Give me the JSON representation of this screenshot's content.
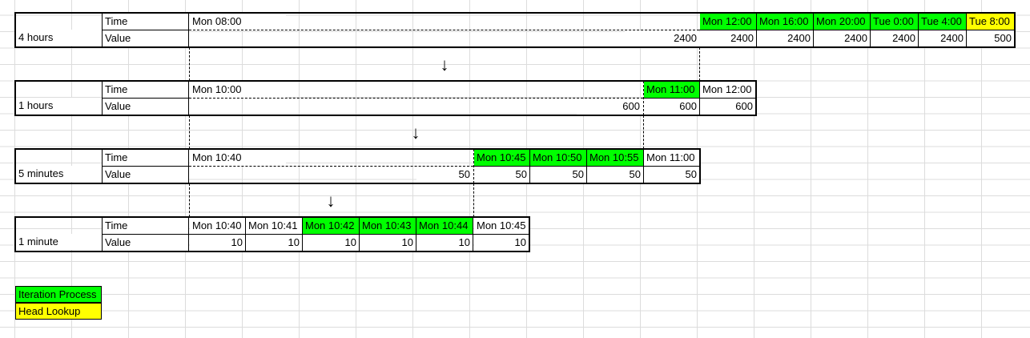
{
  "rows_label": {
    "time": "Time",
    "value": "Value"
  },
  "sections": [
    {
      "resolution": "4 hours",
      "time_cells": [
        "Mon 08:00",
        "Mon 12:00",
        "Mon 16:00",
        "Mon 20:00",
        "Tue 0:00",
        "Tue 4:00",
        "Tue 8:00"
      ],
      "value_cells": [
        "2400",
        "2400",
        "2400",
        "2400",
        "2400",
        "2400",
        "500"
      ],
      "highlight": [
        "none",
        "green",
        "green",
        "green",
        "green",
        "green",
        "yellow"
      ]
    },
    {
      "resolution": "1 hours",
      "time_cells": [
        "Mon 10:00",
        "Mon 11:00",
        "Mon 12:00"
      ],
      "value_cells": [
        "600",
        "600",
        "600"
      ],
      "highlight": [
        "none",
        "green",
        "none"
      ]
    },
    {
      "resolution": "5 minutes",
      "time_cells": [
        "Mon 10:40",
        "Mon 10:45",
        "Mon 10:50",
        "Mon 10:55",
        "Mon 11:00"
      ],
      "value_cells": [
        "50",
        "50",
        "50",
        "50",
        "50"
      ],
      "highlight": [
        "none",
        "green",
        "green",
        "green",
        "none"
      ]
    },
    {
      "resolution": "1 minute",
      "time_cells": [
        "Mon 10:40",
        "Mon 10:41",
        "Mon 10:42",
        "Mon 10:43",
        "Mon 10:44",
        "Mon 10:45"
      ],
      "value_cells": [
        "10",
        "10",
        "10",
        "10",
        "10",
        "10"
      ],
      "highlight": [
        "none",
        "none",
        "green",
        "green",
        "green",
        "none"
      ]
    }
  ],
  "arrow_glyph": "↓",
  "legend": [
    {
      "label": "Iteration Process",
      "color": "#00ff00"
    },
    {
      "label": "Head Lookup",
      "color": "#ffff00"
    }
  ]
}
